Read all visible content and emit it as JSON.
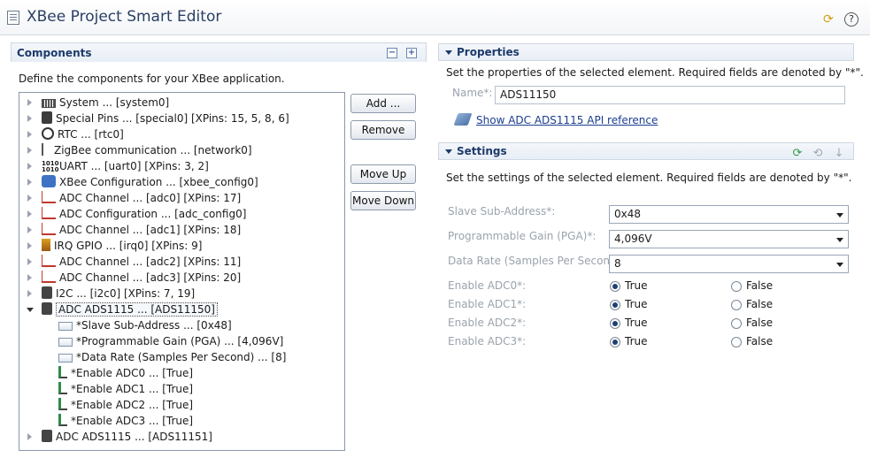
{
  "window": {
    "title": "XBee Project Smart Editor"
  },
  "components": {
    "title": "Components",
    "description": "Define the components for your XBee application.",
    "collapse_label": "−",
    "expand_label": "+",
    "tree": [
      {
        "label": "System ... [system0]",
        "icon": "chip-icon"
      },
      {
        "label": "Special Pins ... [special0] [XPins: 15, 5, 8, 6]",
        "icon": "pins-icon"
      },
      {
        "label": "RTC ... [rtc0]",
        "icon": "clock-icon"
      },
      {
        "label": "ZigBee communication ... [network0]",
        "icon": "antenna-icon"
      },
      {
        "label": "UART ... [uart0] [XPins: 3, 2]",
        "icon": "uart-icon"
      },
      {
        "label": "XBee Configuration ... [xbee_config0]",
        "icon": "xbee-icon"
      },
      {
        "label": "ADC Channel ... [adc0] [XPins: 17]",
        "icon": "adc-icon"
      },
      {
        "label": "ADC Configuration ... [adc_config0]",
        "icon": "adc-icon"
      },
      {
        "label": "ADC Channel ... [adc1] [XPins: 18]",
        "icon": "adc-icon"
      },
      {
        "label": "IRQ GPIO ... [irq0] [XPins: 9]",
        "icon": "irq-icon"
      },
      {
        "label": "ADC Channel ... [adc2] [XPins: 11]",
        "icon": "adc-icon"
      },
      {
        "label": "ADC Channel ... [adc3] [XPins: 20]",
        "icon": "adc-icon"
      },
      {
        "label": "I2C ... [i2c0] [XPins: 7, 19]",
        "icon": "i2c-icon"
      },
      {
        "label": "ADC ADS1115 ... [ADS11150]",
        "icon": "i2c-icon"
      }
    ],
    "children": [
      {
        "label": "*Slave Sub-Address ... [0x48]",
        "icon": "property-icon"
      },
      {
        "label": "*Programmable Gain (PGA) ... [4,096V]",
        "icon": "property-icon"
      },
      {
        "label": "*Data Rate (Samples Per Second) ... [8]",
        "icon": "property-icon"
      },
      {
        "label": "*Enable ADC0 ... [True]",
        "icon": "boolean-icon"
      },
      {
        "label": "*Enable ADC1 ... [True]",
        "icon": "boolean-icon"
      },
      {
        "label": "*Enable ADC2 ... [True]",
        "icon": "boolean-icon"
      },
      {
        "label": "*Enable ADC3 ... [True]",
        "icon": "boolean-icon"
      }
    ],
    "last": {
      "label": "ADC ADS1115 ... [ADS11151]",
      "icon": "i2c-icon"
    }
  },
  "buttons": {
    "add": "Add ...",
    "remove": "Remove",
    "move_up": "Move Up",
    "move_down": "Move Down"
  },
  "properties": {
    "title": "Properties",
    "description": "Set the properties of the selected element. Required fields are denoted by \"*\".",
    "name_label": "Name*:",
    "name_value": "ADS11150",
    "api_link": "Show ADC ADS1115 API reference"
  },
  "settings": {
    "title": "Settings",
    "description": "Set the settings of the selected element. Required fields are denoted by \"*\".",
    "fields": [
      {
        "label": "Slave Sub-Address*:",
        "value": "0x48"
      },
      {
        "label": "Programmable Gain (PGA)*:",
        "value": "4,096V"
      },
      {
        "label": "Data Rate (Samples Per Second)*:",
        "value": "8"
      }
    ],
    "toggles": [
      {
        "label": "Enable ADC0*:",
        "true_label": "True",
        "false_label": "False",
        "value": true
      },
      {
        "label": "Enable ADC1*:",
        "true_label": "True",
        "false_label": "False",
        "value": true
      },
      {
        "label": "Enable ADC2*:",
        "true_label": "True",
        "false_label": "False",
        "value": true
      },
      {
        "label": "Enable ADC3*:",
        "true_label": "True",
        "false_label": "False",
        "value": true
      }
    ]
  },
  "colors": {
    "accent": "#1d3a6a",
    "link": "#1a3d8f"
  }
}
